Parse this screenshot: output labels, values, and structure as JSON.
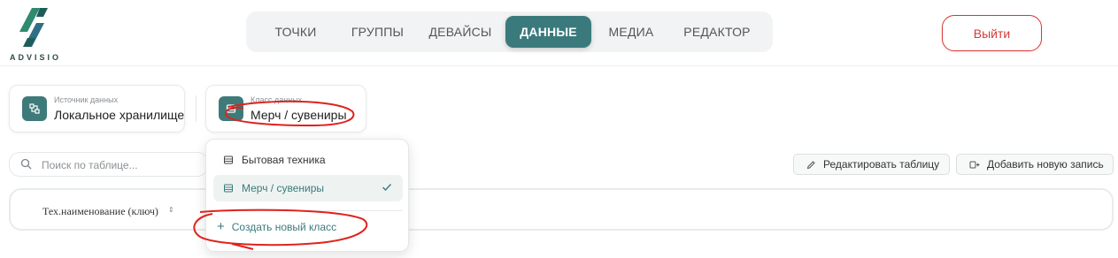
{
  "brand": {
    "name": "ADVISIO",
    "colors": {
      "primary": "#3b7a7c",
      "danger": "#d43a3a",
      "annotation": "#e0221c"
    }
  },
  "nav": {
    "items": [
      {
        "label": "ТОЧКИ"
      },
      {
        "label": "ГРУППЫ"
      },
      {
        "label": "ДЕВАЙСЫ"
      },
      {
        "label": "ДАННЫЕ",
        "active": true
      },
      {
        "label": "МЕДИА"
      },
      {
        "label": "РЕДАКТОР"
      }
    ]
  },
  "header": {
    "logout_label": "Выйти"
  },
  "source": {
    "caption": "Источник данных",
    "value": "Локальное хранилище",
    "icon": "data-source-icon"
  },
  "data_class": {
    "caption": "Класс данных",
    "value": "Мерч / сувениры",
    "icon": "table-icon"
  },
  "search": {
    "placeholder": "Поиск по таблице..."
  },
  "toolbar": {
    "edit_table_label": "Редактировать таблицу",
    "add_record_label": "Добавить новую запись"
  },
  "table": {
    "columns": [
      {
        "label": "Тех.наименование (ключ)",
        "sort_icon": "sort-icon"
      }
    ]
  },
  "dropdown": {
    "options": [
      {
        "label": "Бытовая техника",
        "selected": false
      },
      {
        "label": "Мерч / сувениры",
        "selected": true
      }
    ],
    "create_label": "Создать новый класс"
  }
}
